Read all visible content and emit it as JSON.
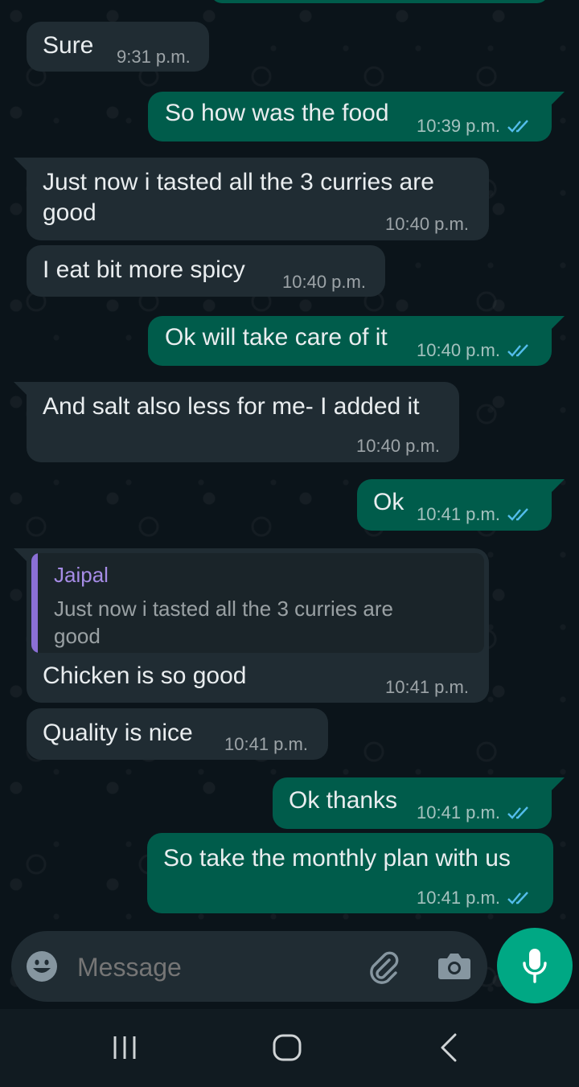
{
  "messages": [
    {
      "id": "m1",
      "dir": "in",
      "text": "Sure",
      "time": "9:31 p.m."
    },
    {
      "id": "m2",
      "dir": "out",
      "text": "So how was the food",
      "time": "10:39 p.m.",
      "status": "read"
    },
    {
      "id": "m3",
      "dir": "in",
      "text_lines": [
        "Just now i tasted all the 3 curries are",
        "good"
      ],
      "time": "10:40 p.m."
    },
    {
      "id": "m4",
      "dir": "in",
      "text": "I eat bit more spicy",
      "time": "10:40 p.m."
    },
    {
      "id": "m5",
      "dir": "out",
      "text": "Ok will take care of it",
      "time": "10:40 p.m.",
      "status": "read"
    },
    {
      "id": "m6",
      "dir": "in",
      "text": "And salt also less for me- I added it",
      "time": "10:40 p.m."
    },
    {
      "id": "m7",
      "dir": "out",
      "text": "Ok",
      "time": "10:41 p.m.",
      "status": "read"
    },
    {
      "id": "m8",
      "dir": "in",
      "reply": {
        "author": "Jaipal",
        "text": "Just now i tasted all the 3 curries are good"
      },
      "text": "Chicken is so good",
      "time": "10:41 p.m."
    },
    {
      "id": "m9",
      "dir": "in",
      "text": "Quality is nice",
      "time": "10:41 p.m."
    },
    {
      "id": "m10",
      "dir": "out",
      "text": "Ok thanks",
      "time": "10:41 p.m.",
      "status": "read"
    },
    {
      "id": "m11",
      "dir": "out",
      "text": "So take the monthly plan with us",
      "time": "10:41 p.m.",
      "status": "read"
    }
  ],
  "composer": {
    "placeholder": "Message",
    "icons": [
      "emoji-icon",
      "attach-icon",
      "camera-icon",
      "mic-icon"
    ]
  },
  "nav": {
    "icons": [
      "recent-apps-icon",
      "home-icon",
      "back-icon"
    ]
  },
  "colors": {
    "background": "#0b141a",
    "incoming": "#202c33",
    "outgoing": "#005c4b",
    "accent": "#00a884",
    "read_tick": "#53bdeb",
    "quote_author": "#a68ce6"
  }
}
